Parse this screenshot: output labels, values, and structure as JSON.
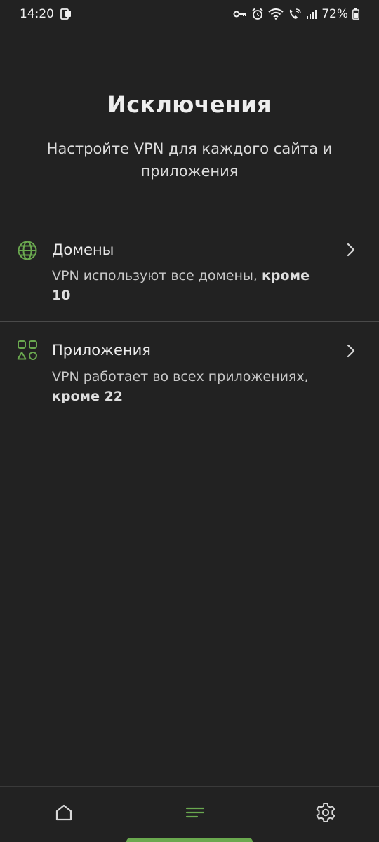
{
  "status_bar": {
    "time": "14:20",
    "battery": "72%"
  },
  "header": {
    "title": "Исключения",
    "subtitle": "Настройте VPN для каждого сайта и приложения"
  },
  "items": [
    {
      "icon": "globe-icon",
      "title": "Домены",
      "desc_text": "VPN используют все домены, ",
      "desc_bold": "кроме 10"
    },
    {
      "icon": "apps-grid-icon",
      "title": "Приложения",
      "desc_text": "VPN работает во всех приложениях, ",
      "desc_bold": "кроме 22"
    }
  ],
  "bottom_nav": {
    "active": "exclusions",
    "items": [
      "home-icon",
      "list-icon",
      "gear-icon"
    ]
  },
  "colors": {
    "background": "#222222",
    "accent": "#6aa84f",
    "divider": "#4a4a4a"
  }
}
